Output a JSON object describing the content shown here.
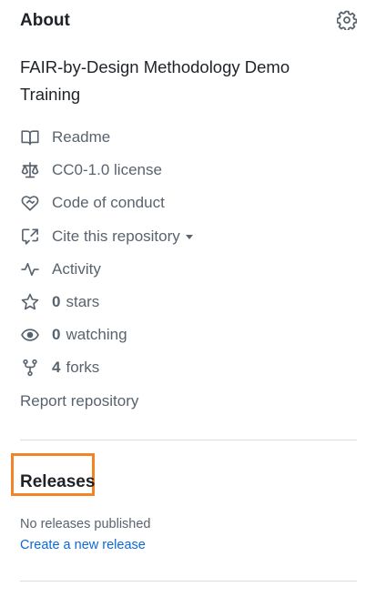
{
  "about": {
    "title": "About",
    "description": "FAIR-by-Design Methodology Demo Training"
  },
  "meta": {
    "readme": "Readme",
    "license": "CC0-1.0 license",
    "conduct": "Code of conduct",
    "cite": "Cite this repository",
    "activity": "Activity",
    "stars_count": "0",
    "stars_label": "stars",
    "watching_count": "0",
    "watching_label": "watching",
    "forks_count": "4",
    "forks_label": "forks",
    "report": "Report repository"
  },
  "releases": {
    "title": "Releases",
    "empty_text": "No releases published",
    "create_link": "Create a new release"
  },
  "colors": {
    "highlight_border": "#f28427",
    "link": "#0969da",
    "muted": "#59636e"
  },
  "icons": [
    "gear-icon",
    "book-icon",
    "law-icon",
    "code-of-conduct-icon",
    "cite-icon",
    "pulse-icon",
    "star-icon",
    "eye-icon",
    "fork-icon",
    "caret-down-icon"
  ]
}
